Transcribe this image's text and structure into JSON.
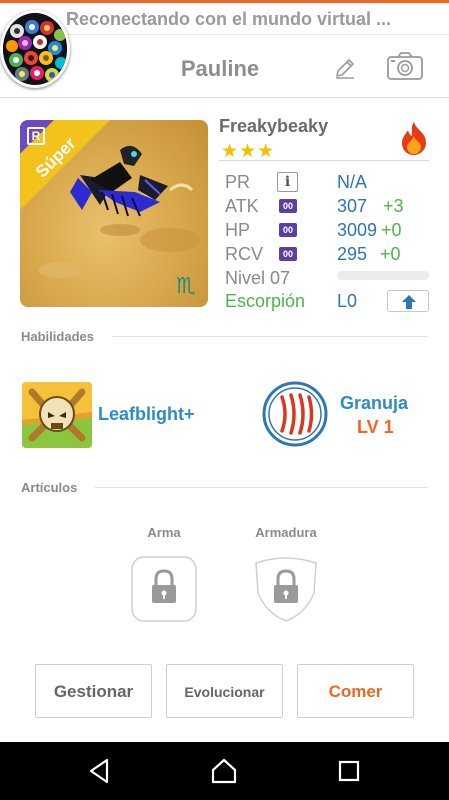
{
  "status_bar": {
    "notice": "Reconectando con el mundo virtual ..."
  },
  "header": {
    "player_name": "Pauline"
  },
  "creature": {
    "name": "Freakybeaky",
    "stars": "★★★",
    "rarity_badge": "R",
    "tier_ribbon": "Súper",
    "zodiac_glyph": "♏",
    "stats": [
      {
        "label": "PR",
        "value": "N/A",
        "bonus": ""
      },
      {
        "label": "ATK",
        "badge": "00",
        "value": "307",
        "bonus": "+3"
      },
      {
        "label": "HP",
        "badge": "00",
        "value": "3009",
        "bonus": "+0"
      },
      {
        "label": "RCV",
        "badge": "00",
        "value": "295",
        "bonus": "+0"
      }
    ],
    "level_label": "Nivel 07",
    "level_progress": 0,
    "species": "Escorpión",
    "species_level": "L0"
  },
  "abilities": {
    "section_title": "Habilidades",
    "items": [
      {
        "name": "Leafblight+"
      },
      {
        "name": "Granuja",
        "level": "LV 1"
      }
    ]
  },
  "articles": {
    "section_title": "Artículos",
    "slots": [
      {
        "label": "Arma"
      },
      {
        "label": "Armadura"
      }
    ]
  },
  "actions": {
    "manage": "Gestionar",
    "evolve": "Evolucionar",
    "eat": "Comer"
  },
  "colors": {
    "accent": "#f26522",
    "stat_value": "#2d77b5",
    "bonus": "#4cb648",
    "ability_name": "#2d8bc9"
  },
  "icons": [
    "avatar",
    "edit-icon",
    "camera-icon",
    "fire-icon",
    "info-icon",
    "stat-badge-icon",
    "upgrade-arrow-icon",
    "leafblight-skull-icon",
    "claw-icon",
    "lock-icon",
    "back-icon",
    "home-icon",
    "recents-icon"
  ]
}
